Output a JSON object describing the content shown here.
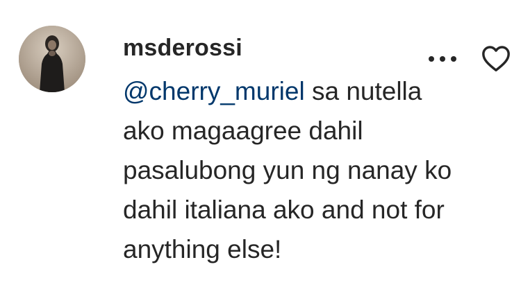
{
  "comment": {
    "username": "msderossi",
    "mention": "@cherry_muriel",
    "text": " sa nutella ako magaagree dahil pasalubong yun ng nanay ko dahil italiana ako and not for anything else!",
    "icons": {
      "avatar": "profile-photo",
      "more": "more-options-icon",
      "like": "heart-outline-icon"
    },
    "colors": {
      "text": "#262626",
      "mention": "#00376b"
    }
  }
}
